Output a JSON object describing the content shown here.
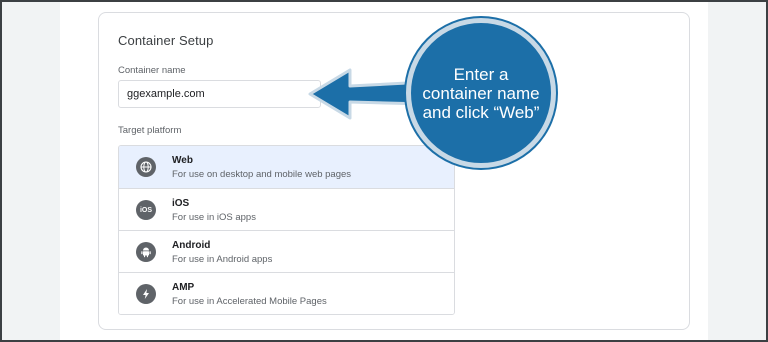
{
  "card": {
    "title": "Container Setup",
    "name_label": "Container name",
    "name_value": "ggexample.com",
    "platform_label": "Target platform"
  },
  "platforms": [
    {
      "name": "Web",
      "desc": "For use on desktop and mobile web pages",
      "icon": "globe-icon",
      "selected": true
    },
    {
      "name": "iOS",
      "desc": "For use in iOS apps",
      "icon": "ios-icon",
      "selected": false
    },
    {
      "name": "Android",
      "desc": "For use in Android apps",
      "icon": "android-icon",
      "selected": false
    },
    {
      "name": "AMP",
      "desc": "For use in Accelerated Mobile Pages",
      "icon": "amp-bolt-icon",
      "selected": false
    }
  ],
  "callout": {
    "text": "Enter a container name and click “Web”"
  },
  "colors": {
    "callout_fill": "#1c6fa8",
    "selected_row": "#e8f0fe"
  }
}
